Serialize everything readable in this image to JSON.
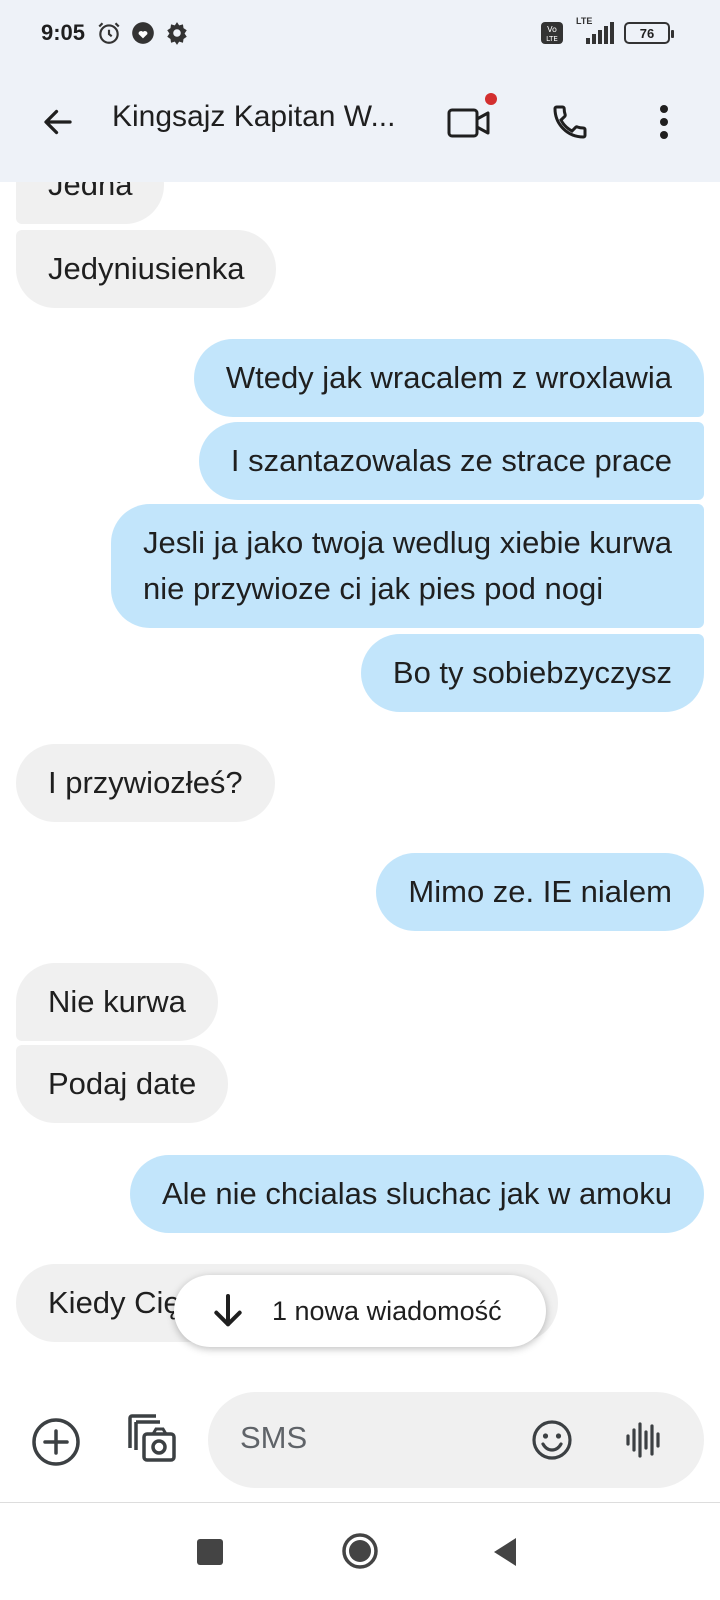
{
  "status_bar": {
    "time": "9:05",
    "battery": "76",
    "network": "LTE",
    "icons": [
      "alarm-icon",
      "heart-icon",
      "settings-icon",
      "volte-icon",
      "signal-icon",
      "battery-icon"
    ]
  },
  "header": {
    "contact_name": "Kingsajz Kapitan W...",
    "icons": [
      "back-arrow-icon",
      "video-call-icon",
      "phone-icon",
      "more-vert-icon"
    ],
    "video_badge_color": "#d32f2f"
  },
  "messages": [
    {
      "direction": "in",
      "text": "Jedna"
    },
    {
      "direction": "in",
      "text": "Jedyniusienka"
    },
    {
      "direction": "out",
      "text": "Wtedy jak wracalem z wroxlawia"
    },
    {
      "direction": "out",
      "text": "I szantazowalas ze strace prace"
    },
    {
      "direction": "out",
      "lines": [
        "Jesli ja jako twoja wedlug xiebie kurwa",
        "nie przywioze ci jak pies pod nogi"
      ]
    },
    {
      "direction": "out",
      "text": "Bo ty sobiebzyczysz"
    },
    {
      "direction": "in",
      "text": "I przywiozłeś?"
    },
    {
      "direction": "out",
      "text": "Mimo ze. IE nialem"
    },
    {
      "direction": "in",
      "text": "Nie kurwa"
    },
    {
      "direction": "in",
      "text": "Podaj date"
    },
    {
      "direction": "out",
      "text": "Ale nie chcialas sluchac jak w amoku"
    },
    {
      "direction": "in",
      "text": "Kiedy Cię"
    }
  ],
  "new_message_pill": {
    "label": "1 nowa wiadomość",
    "icon": "arrow-down-icon"
  },
  "composer": {
    "placeholder": "SMS",
    "icons": [
      "add-circle-icon",
      "gallery-camera-icon",
      "emoji-icon",
      "voice-waveform-icon"
    ]
  },
  "colors": {
    "header_bg": "#eef2f8",
    "incoming_bubble": "#f0f0f0",
    "outgoing_bubble": "#c2e5fb"
  }
}
